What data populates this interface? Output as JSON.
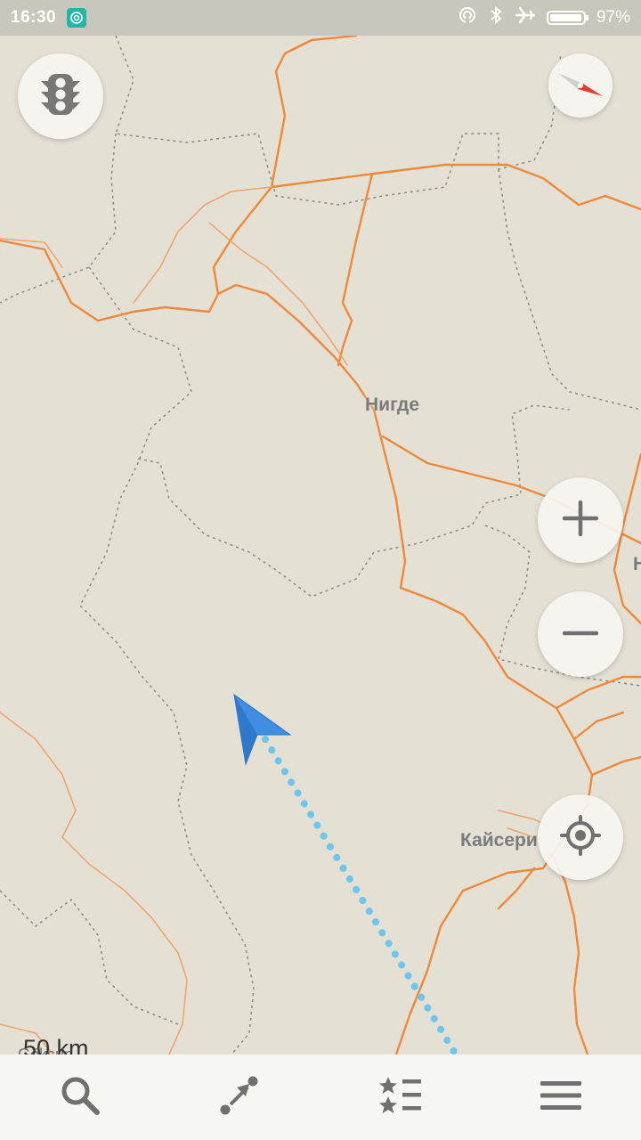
{
  "status_bar": {
    "time": "16:30",
    "battery_percent": "97%",
    "battery_level": 0.97,
    "icons": [
      "hotspot-icon",
      "bluetooth-icon",
      "airplane-mode-icon",
      "battery-icon"
    ]
  },
  "map": {
    "cities": [
      "Нигде",
      "Кайсери",
      "Göksun",
      "Н"
    ],
    "scale_label": "50 km",
    "colors": {
      "background": "#e4e0d4",
      "road": "#f0893a",
      "border": "#8a8a8a",
      "route": "#6ec6ef",
      "position_arrow": "#3f8ee0"
    }
  },
  "controls": {
    "traffic": "traffic-light-icon",
    "compass": "compass-icon",
    "zoom_in": "plus-icon",
    "zoom_out": "minus-icon",
    "my_location": "locate-icon"
  },
  "bottom_nav": [
    "search-icon",
    "route-icon",
    "bookmarks-icon",
    "menu-icon"
  ]
}
